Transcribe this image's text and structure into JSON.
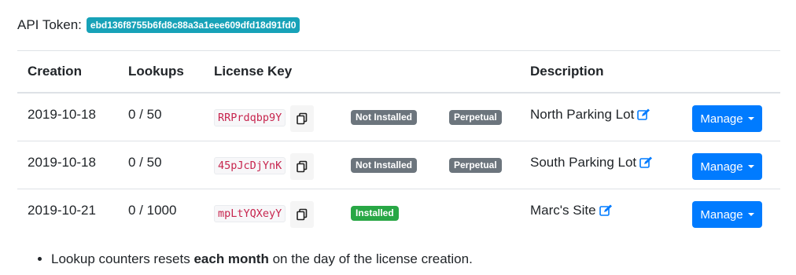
{
  "api_token": {
    "label": "API Token:",
    "value": "ebd136f8755b6fd8c88a3a1eee609dfd18d91fd0",
    "color": "#17a2b8"
  },
  "table": {
    "headers": {
      "creation": "Creation",
      "lookups": "Lookups",
      "license_key": "License Key",
      "description": "Description"
    },
    "rows": [
      {
        "creation": "2019-10-18",
        "lookups": "0 / 50",
        "license_key": "RRPrdqbp9Y",
        "status": "Not Installed",
        "type": "Perpetual",
        "description": "North Parking Lot",
        "action": "Manage"
      },
      {
        "creation": "2019-10-18",
        "lookups": "0 / 50",
        "license_key": "45pJcDjYnK",
        "status": "Not Installed",
        "type": "Perpetual",
        "description": "South Parking Lot",
        "action": "Manage"
      },
      {
        "creation": "2019-10-21",
        "lookups": "0 / 1000",
        "license_key": "mpLtYQXeyY",
        "status": "Installed",
        "type": "",
        "description": "Marc's Site",
        "action": "Manage"
      }
    ]
  },
  "notes": {
    "item1_prefix": "Lookup counters resets ",
    "item1_bold": "each month",
    "item1_suffix": " on the day of the license creation."
  },
  "colors": {
    "primary": "#007bff",
    "status_installed": "#28a745",
    "status_not_installed": "#6c757d"
  }
}
